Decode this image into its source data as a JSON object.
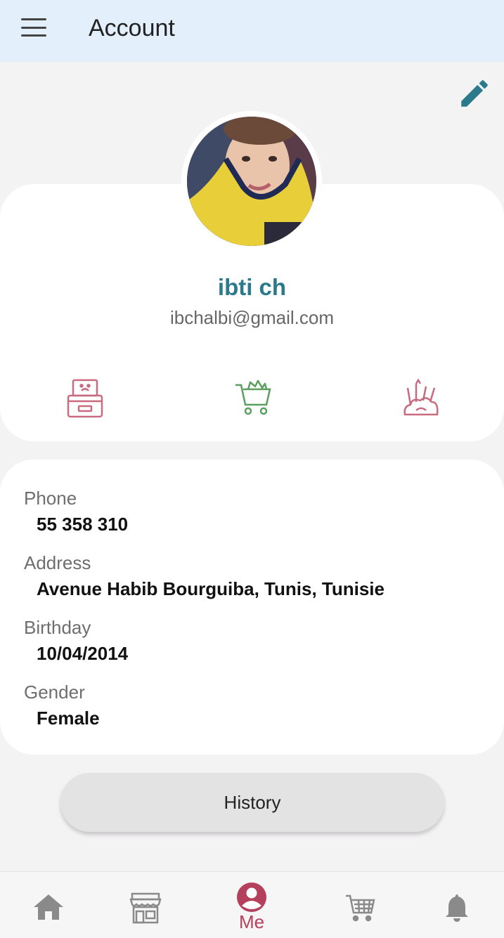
{
  "appbar": {
    "title": "Account",
    "icon_menu": "menu-icon",
    "icon_edit": "pencil-icon"
  },
  "profile": {
    "name": "ibti ch",
    "email": "ibchalbi@gmail.com",
    "avatar": "child-photo-avatar"
  },
  "quick_actions": [
    {
      "icon": "cash-register-icon",
      "color": "#c96b80"
    },
    {
      "icon": "shopping-cart-icon",
      "color": "#5c9e5e"
    },
    {
      "icon": "school-supplies-icon",
      "color": "#c96b80"
    }
  ],
  "info": {
    "phone_label": "Phone",
    "phone_value": "55 358 310",
    "address_label": "Address",
    "address_value": "Avenue Habib Bourguiba, Tunis, Tunisie",
    "birthday_label": "Birthday",
    "birthday_value": "10/04/2014",
    "gender_label": "Gender",
    "gender_value": "Female"
  },
  "history_button": "History",
  "bottom_nav": {
    "items": [
      {
        "icon": "home-icon"
      },
      {
        "icon": "store-icon"
      },
      {
        "icon": "account-circle-icon",
        "label": "Me",
        "active": true
      },
      {
        "icon": "cart-icon"
      },
      {
        "icon": "bell-icon"
      }
    ]
  },
  "colors": {
    "accent": "#2b7a8c",
    "active": "#b5405e",
    "appbar": "#e3f0fb"
  }
}
